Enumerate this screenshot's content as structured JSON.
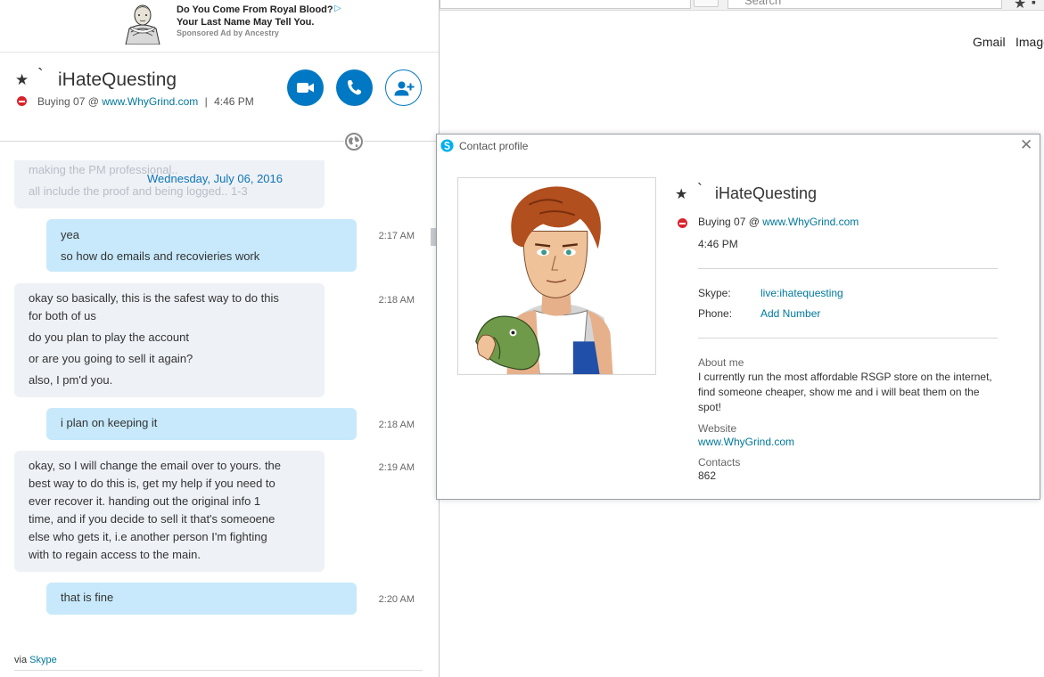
{
  "ad": {
    "title_line1": "Do You Come From Royal Blood?",
    "title_line2": "Your Last Name May Tell You.",
    "sponsor": "Sponsored Ad by Ancestry"
  },
  "browser": {
    "search_placeholder": "Search",
    "links": [
      "Gmail",
      "Image"
    ]
  },
  "chat": {
    "contact_name": "iHateQuesting",
    "star_glyph": "★",
    "tick_glyph": "`",
    "status": {
      "mood_prefix": "Buying 07 @",
      "mood_link": "www.WhyGrind.com",
      "separator": "|",
      "local_time": "4:46 PM"
    },
    "faded_lines": [
      "making the PM professional..",
      "all include the proof and being logged.. 1-3"
    ],
    "date_separator": "Wednesday, July 06, 2016",
    "messages": [
      {
        "direction": "out",
        "time": "2:17 AM",
        "lines": [
          "yea",
          "so how do emails and recovieries work"
        ]
      },
      {
        "direction": "in",
        "time": "2:18 AM",
        "lines": [
          "okay so basically, this is the safest way to do this",
          "for both of us",
          "do you plan to play the account",
          "or are you going to sell it again?",
          "also, I pm'd you."
        ]
      },
      {
        "direction": "out",
        "time": "2:18 AM",
        "lines": [
          "i plan on keeping it"
        ]
      },
      {
        "direction": "in",
        "time": "2:19 AM",
        "lines": [
          "okay, so I will change the email over to yours. the",
          "best way to do this is, get my help if you need to",
          "ever recover it. handing out the original info 1",
          "time, and if you decide to sell it that's someoene",
          "else who gets it, i.e another person I'm fighting",
          "with to regain access to the main."
        ]
      },
      {
        "direction": "out",
        "time": "2:20 AM",
        "lines": [
          "that is fine"
        ]
      }
    ],
    "via_prefix": "via",
    "via_link": "Skype",
    "icons": [
      "video-call-icon",
      "audio-call-icon",
      "add-people-icon",
      "globe-icon"
    ],
    "accent_color": "#0078c3"
  },
  "profile": {
    "window_title": "Contact profile",
    "close_glyph": "✕",
    "name": "iHateQuesting",
    "star_glyph": "★",
    "tick_glyph": "`",
    "mood_prefix": "Buying 07 @",
    "mood_link": "www.WhyGrind.com",
    "local_time": "4:46 PM",
    "skype_label": "Skype:",
    "skype_value": "live:ihatequesting",
    "phone_label": "Phone:",
    "phone_value": "Add Number",
    "about_label": "About me",
    "about_text": "I currently run the most affordable RSGP store on the internet, find someone cheaper, show me and i will beat them on the spot!",
    "website_label": "Website",
    "website_value": "www.WhyGrind.com",
    "contacts_label": "Contacts",
    "contacts_value": "862"
  }
}
